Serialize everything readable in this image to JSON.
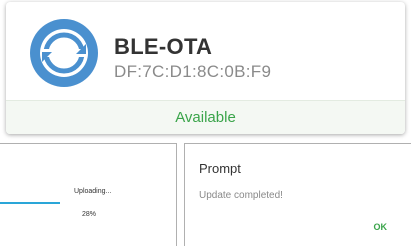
{
  "colors": {
    "accent_blue": "#4a90cf",
    "status_green": "#3aa44a",
    "progress_blue": "#2aa6d8"
  },
  "device_card": {
    "icon": "sync-icon",
    "name": "BLE-OTA",
    "mac": "DF:7C:D1:8C:0B:F9",
    "status": "Available"
  },
  "upload_panel": {
    "status_text": "Uploading...",
    "percent_label": "28%",
    "progress_fraction": 0.28
  },
  "prompt_dialog": {
    "title": "Prompt",
    "message": "Update completed!",
    "ok_label": "OK"
  }
}
